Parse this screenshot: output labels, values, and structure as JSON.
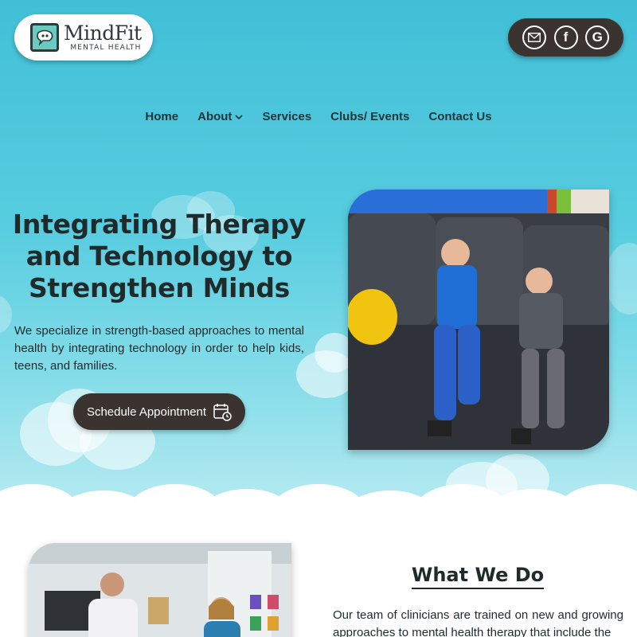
{
  "brand": {
    "name": "MindFit",
    "tagline": "MENTAL HEALTH",
    "accent_color": "#41bfd7",
    "dark_color": "#3a3330"
  },
  "social": [
    {
      "name": "email",
      "icon": "envelope-icon"
    },
    {
      "name": "facebook",
      "icon": "facebook-icon",
      "glyph": "f"
    },
    {
      "name": "google",
      "icon": "google-icon",
      "glyph": "G"
    }
  ],
  "nav": {
    "items": [
      {
        "label": "Home"
      },
      {
        "label": "About",
        "has_dropdown": true
      },
      {
        "label": "Services"
      },
      {
        "label": "Clubs/ Events"
      },
      {
        "label": "Contact Us"
      }
    ]
  },
  "hero": {
    "title": "Integrating Therapy and Technology to Strengthen Minds",
    "description": "We specialize in strength-based approaches to mental health by integrating technology in order to help kids, teens, and families.",
    "cta_label": "Schedule Appointment"
  },
  "what_we_do": {
    "title": "What We Do",
    "text": "Our team of clinicians are trained on new and growing approaches to mental health therapy that include the"
  }
}
